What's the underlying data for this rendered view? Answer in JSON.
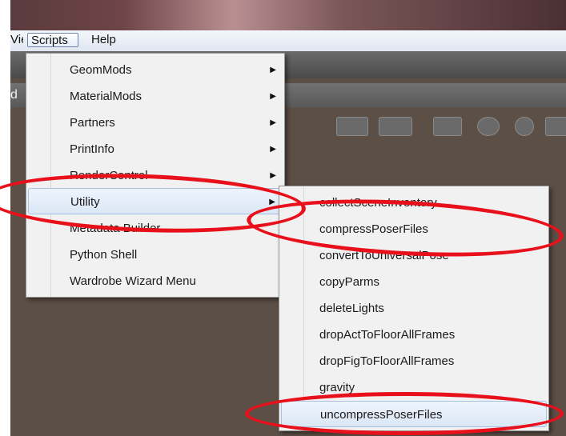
{
  "menubar": {
    "view_label": "View",
    "scripts_label": "Scripts",
    "help_label": "Help"
  },
  "panel": {
    "label": "d"
  },
  "scripts_menu": {
    "items": [
      {
        "label": "GeomMods",
        "has_submenu": true
      },
      {
        "label": "MaterialMods",
        "has_submenu": true
      },
      {
        "label": "Partners",
        "has_submenu": true
      },
      {
        "label": "PrintInfo",
        "has_submenu": true
      },
      {
        "label": "RenderControl",
        "has_submenu": true
      },
      {
        "label": "Utility",
        "has_submenu": true
      },
      {
        "label": "Metadata Builder",
        "has_submenu": false
      },
      {
        "label": "Python Shell",
        "has_submenu": false
      },
      {
        "label": "Wardrobe Wizard Menu",
        "has_submenu": false
      }
    ],
    "highlighted": "Utility"
  },
  "utility_menu": {
    "items": [
      "collectSceneInventory",
      "compressPoserFiles",
      "convertToUniversalPose",
      "copyParms",
      "deleteLights",
      "dropActToFloorAllFrames",
      "dropFigToFloorAllFrames",
      "gravity",
      "uncompressPoserFiles"
    ],
    "highlighted": "uncompressPoserFiles"
  },
  "colors": {
    "annotation_red": "#e8101a",
    "menu_bg": "#f1f1f1",
    "workspace_bg": "#5c4f45"
  }
}
